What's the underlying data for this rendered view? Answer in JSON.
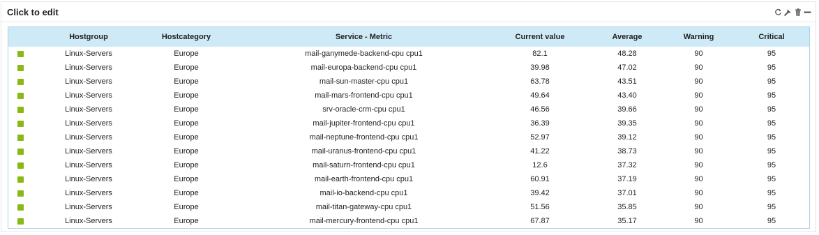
{
  "widget": {
    "title": "Click to edit",
    "tools": [
      "refresh-icon",
      "wrench-icon",
      "trash-icon",
      "minimize-icon"
    ]
  },
  "table": {
    "columns": {
      "status": "",
      "hostgroup": "Hostgroup",
      "hostcategory": "Hostcategory",
      "service_metric": "Service - Metric",
      "current_value": "Current value",
      "average": "Average",
      "warning": "Warning",
      "critical": "Critical"
    },
    "status_color": "#88b917",
    "header_bg": "#cfeaf7",
    "rows": [
      {
        "hostgroup": "Linux-Servers",
        "hostcategory": "Europe",
        "service_metric": "mail-ganymede-backend-cpu cpu1",
        "current_value": "82.1",
        "average": "48.28",
        "warning": "90",
        "critical": "95"
      },
      {
        "hostgroup": "Linux-Servers",
        "hostcategory": "Europe",
        "service_metric": "mail-europa-backend-cpu cpu1",
        "current_value": "39.98",
        "average": "47.02",
        "warning": "90",
        "critical": "95"
      },
      {
        "hostgroup": "Linux-Servers",
        "hostcategory": "Europe",
        "service_metric": "mail-sun-master-cpu cpu1",
        "current_value": "63.78",
        "average": "43.51",
        "warning": "90",
        "critical": "95"
      },
      {
        "hostgroup": "Linux-Servers",
        "hostcategory": "Europe",
        "service_metric": "mail-mars-frontend-cpu cpu1",
        "current_value": "49.64",
        "average": "43.40",
        "warning": "90",
        "critical": "95"
      },
      {
        "hostgroup": "Linux-Servers",
        "hostcategory": "Europe",
        "service_metric": "srv-oracle-crm-cpu cpu1",
        "current_value": "46.56",
        "average": "39.66",
        "warning": "90",
        "critical": "95"
      },
      {
        "hostgroup": "Linux-Servers",
        "hostcategory": "Europe",
        "service_metric": "mail-jupiter-frontend-cpu cpu1",
        "current_value": "36.39",
        "average": "39.35",
        "warning": "90",
        "critical": "95"
      },
      {
        "hostgroup": "Linux-Servers",
        "hostcategory": "Europe",
        "service_metric": "mail-neptune-frontend-cpu cpu1",
        "current_value": "52.97",
        "average": "39.12",
        "warning": "90",
        "critical": "95"
      },
      {
        "hostgroup": "Linux-Servers",
        "hostcategory": "Europe",
        "service_metric": "mail-uranus-frontend-cpu cpu1",
        "current_value": "41.22",
        "average": "38.73",
        "warning": "90",
        "critical": "95"
      },
      {
        "hostgroup": "Linux-Servers",
        "hostcategory": "Europe",
        "service_metric": "mail-saturn-frontend-cpu cpu1",
        "current_value": "12.6",
        "average": "37.32",
        "warning": "90",
        "critical": "95"
      },
      {
        "hostgroup": "Linux-Servers",
        "hostcategory": "Europe",
        "service_metric": "mail-earth-frontend-cpu cpu1",
        "current_value": "60.91",
        "average": "37.19",
        "warning": "90",
        "critical": "95"
      },
      {
        "hostgroup": "Linux-Servers",
        "hostcategory": "Europe",
        "service_metric": "mail-io-backend-cpu cpu1",
        "current_value": "39.42",
        "average": "37.01",
        "warning": "90",
        "critical": "95"
      },
      {
        "hostgroup": "Linux-Servers",
        "hostcategory": "Europe",
        "service_metric": "mail-titan-gateway-cpu cpu1",
        "current_value": "51.56",
        "average": "35.85",
        "warning": "90",
        "critical": "95"
      },
      {
        "hostgroup": "Linux-Servers",
        "hostcategory": "Europe",
        "service_metric": "mail-mercury-frontend-cpu cpu1",
        "current_value": "67.87",
        "average": "35.17",
        "warning": "90",
        "critical": "95"
      }
    ]
  }
}
